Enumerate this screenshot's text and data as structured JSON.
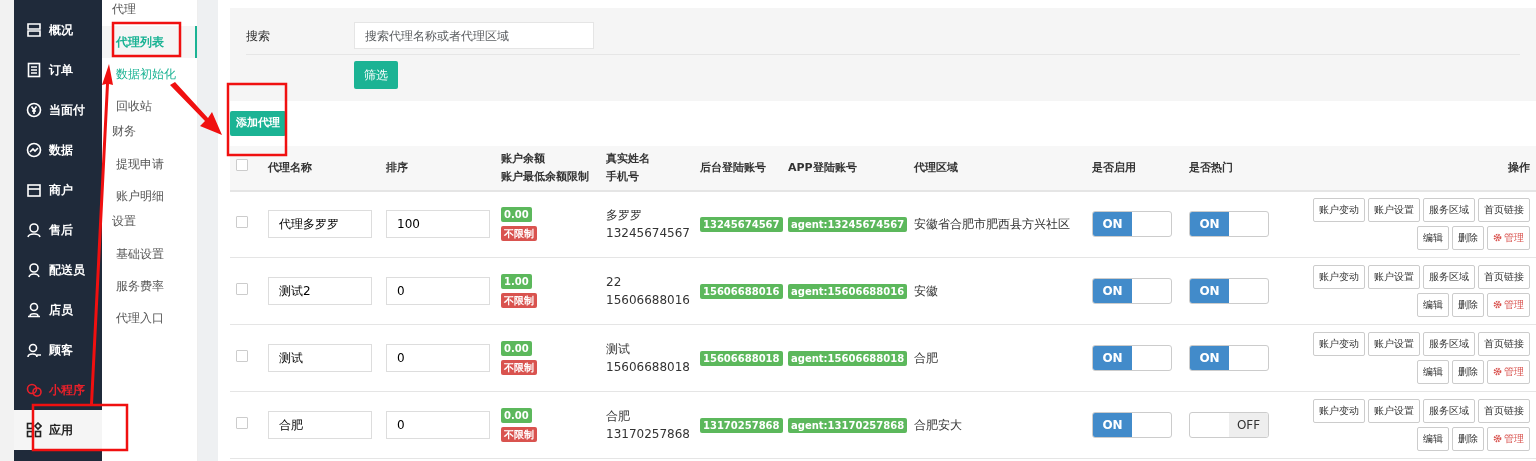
{
  "sidebar": {
    "items": [
      {
        "label": "概况",
        "selected": false,
        "highlighted": false
      },
      {
        "label": "订单",
        "selected": false,
        "highlighted": false
      },
      {
        "label": "当面付",
        "selected": false,
        "highlighted": false
      },
      {
        "label": "数据",
        "selected": false,
        "highlighted": false
      },
      {
        "label": "商户",
        "selected": false,
        "highlighted": false
      },
      {
        "label": "售后",
        "selected": false,
        "highlighted": false
      },
      {
        "label": "配送员",
        "selected": false,
        "highlighted": false
      },
      {
        "label": "店员",
        "selected": false,
        "highlighted": false
      },
      {
        "label": "顾客",
        "selected": false,
        "highlighted": false
      },
      {
        "label": "小程序",
        "selected": false,
        "highlighted": true
      },
      {
        "label": "应用",
        "selected": true,
        "highlighted": false
      }
    ]
  },
  "submenu": {
    "groups": [
      {
        "title": "代理",
        "items": [
          {
            "label": "代理列表",
            "selected": true,
            "highlighted": true
          },
          {
            "label": "数据初始化",
            "selected": false,
            "highlighted": true
          },
          {
            "label": "回收站",
            "selected": false,
            "highlighted": false
          }
        ]
      },
      {
        "title": "财务",
        "items": [
          {
            "label": "提现申请",
            "selected": false,
            "highlighted": false
          },
          {
            "label": "账户明细",
            "selected": false,
            "highlighted": false
          }
        ]
      },
      {
        "title": "设置",
        "items": [
          {
            "label": "基础设置",
            "selected": false,
            "highlighted": false
          },
          {
            "label": "服务费率",
            "selected": false,
            "highlighted": false
          },
          {
            "label": "代理入口",
            "selected": false,
            "highlighted": false
          }
        ]
      }
    ]
  },
  "filter": {
    "label": "搜索",
    "search": {
      "placeholder": "搜索代理名称或者代理区域"
    },
    "button": "筛选"
  },
  "add_button": "添加代理",
  "table": {
    "all_checked": false,
    "columns": [
      {
        "lines": [
          "代理名称"
        ]
      },
      {
        "lines": [
          "排序"
        ]
      },
      {
        "lines": [
          "账户余额",
          "账户最低余额限制"
        ]
      },
      {
        "lines": [
          "真实姓名",
          "手机号"
        ]
      },
      {
        "lines": [
          "后台登陆账号"
        ]
      },
      {
        "lines": [
          "APP登陆账号"
        ]
      },
      {
        "lines": [
          "代理区域"
        ]
      },
      {
        "lines": [
          "是否启用"
        ]
      },
      {
        "lines": [
          "是否热门"
        ]
      },
      {
        "lines": [
          "操作"
        ]
      }
    ],
    "rows": [
      {
        "checked": false,
        "name": "代理多罗罗",
        "sort": "100",
        "balance": "0.00",
        "limit": "不限制",
        "real_name": "多罗罗",
        "phone": "13245674567",
        "backend_account": "13245674567",
        "app_account": "agent:13245674567",
        "region": "安徽省合肥市肥西县方兴社区",
        "enabled": {
          "on": true,
          "label": "ON"
        },
        "hot": {
          "on": true,
          "label": "ON"
        },
        "actions": [
          {
            "label": "账户变动",
            "kind": "default"
          },
          {
            "label": "账户设置",
            "kind": "default"
          },
          {
            "label": "服务区域",
            "kind": "default"
          },
          {
            "label": "首页链接",
            "kind": "default"
          },
          {
            "label": "编辑",
            "kind": "default"
          },
          {
            "label": "删除",
            "kind": "default"
          },
          {
            "label": "管理",
            "kind": "danger"
          }
        ]
      },
      {
        "checked": false,
        "name": "测试2",
        "sort": "0",
        "balance": "1.00",
        "limit": "不限制",
        "real_name": "22",
        "phone": "15606688016",
        "backend_account": "15606688016",
        "app_account": "agent:15606688016",
        "region": "安徽",
        "enabled": {
          "on": true,
          "label": "ON"
        },
        "hot": {
          "on": true,
          "label": "ON"
        },
        "actions": [
          {
            "label": "账户变动",
            "kind": "default"
          },
          {
            "label": "账户设置",
            "kind": "default"
          },
          {
            "label": "服务区域",
            "kind": "default"
          },
          {
            "label": "首页链接",
            "kind": "default"
          },
          {
            "label": "编辑",
            "kind": "default"
          },
          {
            "label": "删除",
            "kind": "default"
          },
          {
            "label": "管理",
            "kind": "danger"
          }
        ]
      },
      {
        "checked": false,
        "name": "测试",
        "sort": "0",
        "balance": "0.00",
        "limit": "不限制",
        "real_name": "测试",
        "phone": "15606688018",
        "backend_account": "15606688018",
        "app_account": "agent:15606688018",
        "region": "合肥",
        "enabled": {
          "on": true,
          "label": "ON"
        },
        "hot": {
          "on": true,
          "label": "ON"
        },
        "actions": [
          {
            "label": "账户变动",
            "kind": "default"
          },
          {
            "label": "账户设置",
            "kind": "default"
          },
          {
            "label": "服务区域",
            "kind": "default"
          },
          {
            "label": "首页链接",
            "kind": "default"
          },
          {
            "label": "编辑",
            "kind": "default"
          },
          {
            "label": "删除",
            "kind": "default"
          },
          {
            "label": "管理",
            "kind": "danger"
          }
        ]
      },
      {
        "checked": false,
        "name": "合肥",
        "sort": "0",
        "balance": "0.00",
        "limit": "不限制",
        "real_name": "合肥",
        "phone": "13170257868",
        "backend_account": "13170257868",
        "app_account": "agent:13170257868",
        "region": "合肥安大",
        "enabled": {
          "on": true,
          "label": "ON"
        },
        "hot": {
          "on": false,
          "label": "OFF"
        },
        "actions": [
          {
            "label": "账户变动",
            "kind": "default"
          },
          {
            "label": "账户设置",
            "kind": "default"
          },
          {
            "label": "服务区域",
            "kind": "default"
          },
          {
            "label": "首页链接",
            "kind": "default"
          },
          {
            "label": "编辑",
            "kind": "default"
          },
          {
            "label": "删除",
            "kind": "default"
          },
          {
            "label": "管理",
            "kind": "danger"
          }
        ]
      }
    ]
  }
}
